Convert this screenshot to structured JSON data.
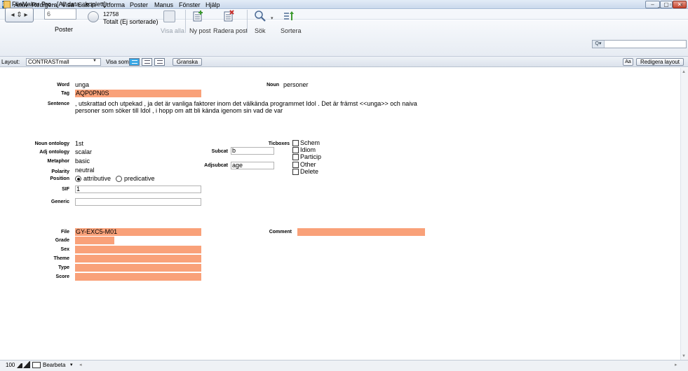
{
  "window": {
    "title": "FileMaker Pro - [All data - koplett]",
    "logo_text": "FM"
  },
  "menu": [
    "Arkiv",
    "Redigera",
    "Visa",
    "Sätt in",
    "Utforma",
    "Poster",
    "Manus",
    "Fönster",
    "Hjälp"
  ],
  "toolbar": {
    "record_number": "6",
    "records_label": "Poster",
    "found_count": "12758",
    "found_status": "Totalt (Ej sorterade)",
    "show_all": "Visa alla",
    "new_record": "Ny post",
    "delete_record": "Radera post",
    "find": "Sök",
    "sort": "Sortera",
    "quickfind_placeholder": ""
  },
  "layoutbar": {
    "layout_label": "Layout:",
    "layout_value": "CONTRASTmall",
    "view_as_label": "Visa som:",
    "preview_button": "Granska",
    "aa_button": "Aa",
    "edit_layout_button": "Redigera layout"
  },
  "record": {
    "word_label": "Word",
    "word": "unga",
    "tag_label": "Tag",
    "tag": "AQP0PN0S",
    "noun_label": "Noun",
    "noun": "personer",
    "sentence_label": "Sentence",
    "sentence_line1": ", utskrattad och utpekad , ja det är vanliga faktorer inom det välkända programmet Idol . Det är främst <<unga>> och naiva",
    "sentence_line2": "personer som söker till Idol , i hopp om att bli kända igenom sin vad de var",
    "noun_ontology_label": "Noun ontology",
    "noun_ontology": "1st",
    "adj_ontology_label": "Adj ontology",
    "adj_ontology": "scalar",
    "metaphor_label": "Metaphor",
    "metaphor": "basic",
    "polarity_label": "Polarity",
    "polarity": "neutral",
    "position_label": "Position",
    "position_options": [
      "attributive",
      "predicative"
    ],
    "position_selected": "attributive",
    "sif_label": "SIF",
    "sif": "1",
    "generic_label": "Generic",
    "generic": "",
    "subcat_label": "Subcat",
    "subcat": "b",
    "adjsubcat_label": "Adjsubcat",
    "adjsubcat": "age",
    "ticboxes_label": "Ticboxes",
    "ticboxes": [
      {
        "label": "Schem",
        "checked": false
      },
      {
        "label": "Idiom",
        "checked": false
      },
      {
        "label": "Particip",
        "checked": false
      },
      {
        "label": "Other",
        "checked": false
      },
      {
        "label": "Delete",
        "checked": false
      }
    ],
    "file_label": "File",
    "file": "GY-EXC5-M01",
    "comment_label": "Comment",
    "comment": "",
    "grade_label": "Grade",
    "grade": "",
    "sex_label": "Sex",
    "sex": "",
    "theme_label": "Theme",
    "theme": "",
    "type_label": "Type",
    "type": "",
    "score_label": "Score",
    "score": ""
  },
  "statusbar": {
    "zoom": "100",
    "mode": "Bearbeta"
  },
  "colors": {
    "field_highlight": "#f9a179",
    "view_active": "#39a8e6"
  }
}
